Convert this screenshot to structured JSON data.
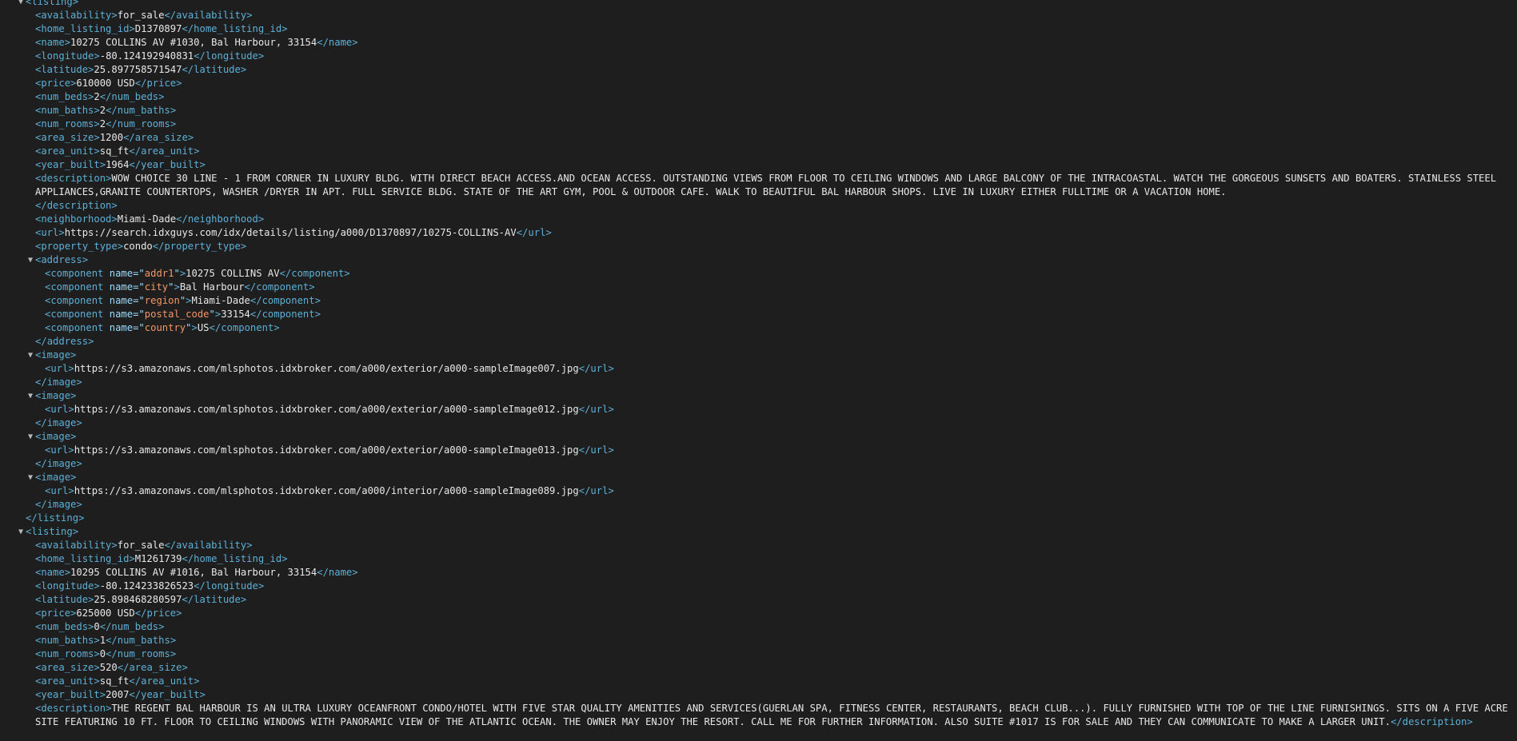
{
  "toggle_glyph": "▼",
  "lines": [
    {
      "d": 1,
      "k": "open",
      "tag": "listing",
      "toggle": true
    },
    {
      "d": 2,
      "k": "el",
      "tag": "availability",
      "text": "for_sale"
    },
    {
      "d": 2,
      "k": "el",
      "tag": "home_listing_id",
      "text": "D1370897"
    },
    {
      "d": 2,
      "k": "el",
      "tag": "name",
      "text": "10275 COLLINS AV #1030, Bal Harbour, 33154"
    },
    {
      "d": 2,
      "k": "el",
      "tag": "longitude",
      "text": "-80.124192940831"
    },
    {
      "d": 2,
      "k": "el",
      "tag": "latitude",
      "text": "25.897758571547"
    },
    {
      "d": 2,
      "k": "el",
      "tag": "price",
      "text": "610000 USD"
    },
    {
      "d": 2,
      "k": "el",
      "tag": "num_beds",
      "text": "2"
    },
    {
      "d": 2,
      "k": "el",
      "tag": "num_baths",
      "text": "2"
    },
    {
      "d": 2,
      "k": "el",
      "tag": "num_rooms",
      "text": "2"
    },
    {
      "d": 2,
      "k": "el",
      "tag": "area_size",
      "text": "1200"
    },
    {
      "d": 2,
      "k": "el",
      "tag": "area_unit",
      "text": "sq_ft"
    },
    {
      "d": 2,
      "k": "el",
      "tag": "year_built",
      "text": "1964"
    },
    {
      "d": 2,
      "k": "desc",
      "tag": "description",
      "text": "WOW CHOICE 30 LINE - 1 FROM CORNER IN LUXURY BLDG. WITH DIRECT BEACH ACCESS.AND OCEAN ACCESS. OUTSTANDING VIEWS FROM FLOOR TO CEILING WINDOWS AND LARGE BALCONY OF THE INTRACOASTAL. WATCH THE GORGEOUS SUNSETS AND BOATERS. STAINLESS STEEL APPLIANCES,GRANITE COUNTERTOPS, WASHER /DRYER IN APT. FULL SERVICE BLDG. STATE OF THE ART GYM, POOL & OUTDOOR CAFE. WALK TO BEAUTIFUL BAL HARBOUR SHOPS. LIVE IN LUXURY EITHER FULLTIME OR A VACATION HOME."
    },
    {
      "d": 2,
      "k": "close",
      "tag": "description"
    },
    {
      "d": 2,
      "k": "el",
      "tag": "neighborhood",
      "text": "Miami-Dade"
    },
    {
      "d": 2,
      "k": "el",
      "tag": "url",
      "text": "https://search.idxguys.com/idx/details/listing/a000/D1370897/10275-COLLINS-AV"
    },
    {
      "d": 2,
      "k": "el",
      "tag": "property_type",
      "text": "condo"
    },
    {
      "d": 2,
      "k": "open",
      "tag": "address",
      "toggle": true
    },
    {
      "d": 3,
      "k": "attr",
      "tag": "component",
      "an": "name",
      "av": "addr1",
      "text": "10275 COLLINS AV"
    },
    {
      "d": 3,
      "k": "attr",
      "tag": "component",
      "an": "name",
      "av": "city",
      "text": "Bal Harbour"
    },
    {
      "d": 3,
      "k": "attr",
      "tag": "component",
      "an": "name",
      "av": "region",
      "text": "Miami-Dade"
    },
    {
      "d": 3,
      "k": "attr",
      "tag": "component",
      "an": "name",
      "av": "postal_code",
      "text": "33154"
    },
    {
      "d": 3,
      "k": "attr",
      "tag": "component",
      "an": "name",
      "av": "country",
      "text": "US"
    },
    {
      "d": 2,
      "k": "close",
      "tag": "address"
    },
    {
      "d": 2,
      "k": "open",
      "tag": "image",
      "toggle": true
    },
    {
      "d": 3,
      "k": "el",
      "tag": "url",
      "text": "https://s3.amazonaws.com/mlsphotos.idxbroker.com/a000/exterior/a000-sampleImage007.jpg"
    },
    {
      "d": 2,
      "k": "close",
      "tag": "image"
    },
    {
      "d": 2,
      "k": "open",
      "tag": "image",
      "toggle": true
    },
    {
      "d": 3,
      "k": "el",
      "tag": "url",
      "text": "https://s3.amazonaws.com/mlsphotos.idxbroker.com/a000/exterior/a000-sampleImage012.jpg"
    },
    {
      "d": 2,
      "k": "close",
      "tag": "image"
    },
    {
      "d": 2,
      "k": "open",
      "tag": "image",
      "toggle": true
    },
    {
      "d": 3,
      "k": "el",
      "tag": "url",
      "text": "https://s3.amazonaws.com/mlsphotos.idxbroker.com/a000/exterior/a000-sampleImage013.jpg"
    },
    {
      "d": 2,
      "k": "close",
      "tag": "image"
    },
    {
      "d": 2,
      "k": "open",
      "tag": "image",
      "toggle": true
    },
    {
      "d": 3,
      "k": "el",
      "tag": "url",
      "text": "https://s3.amazonaws.com/mlsphotos.idxbroker.com/a000/interior/a000-sampleImage089.jpg"
    },
    {
      "d": 2,
      "k": "close",
      "tag": "image"
    },
    {
      "d": 1,
      "k": "close",
      "tag": "listing"
    },
    {
      "d": 1,
      "k": "open",
      "tag": "listing",
      "toggle": true
    },
    {
      "d": 2,
      "k": "el",
      "tag": "availability",
      "text": "for_sale"
    },
    {
      "d": 2,
      "k": "el",
      "tag": "home_listing_id",
      "text": "M1261739"
    },
    {
      "d": 2,
      "k": "el",
      "tag": "name",
      "text": "10295 COLLINS AV #1016, Bal Harbour, 33154"
    },
    {
      "d": 2,
      "k": "el",
      "tag": "longitude",
      "text": "-80.124233826523"
    },
    {
      "d": 2,
      "k": "el",
      "tag": "latitude",
      "text": "25.898468280597"
    },
    {
      "d": 2,
      "k": "el",
      "tag": "price",
      "text": "625000 USD"
    },
    {
      "d": 2,
      "k": "el",
      "tag": "num_beds",
      "text": "0"
    },
    {
      "d": 2,
      "k": "el",
      "tag": "num_baths",
      "text": "1"
    },
    {
      "d": 2,
      "k": "el",
      "tag": "num_rooms",
      "text": "0"
    },
    {
      "d": 2,
      "k": "el",
      "tag": "area_size",
      "text": "520"
    },
    {
      "d": 2,
      "k": "el",
      "tag": "area_unit",
      "text": "sq_ft"
    },
    {
      "d": 2,
      "k": "el",
      "tag": "year_built",
      "text": "2007"
    },
    {
      "d": 2,
      "k": "desc",
      "tag": "description",
      "text": "THE REGENT BAL HARBOUR IS AN ULTRA LUXURY OCEANFRONT CONDO/HOTEL WITH FIVE STAR QUALITY AMENITIES AND SERVICES(GUERLAN SPA, FITNESS CENTER, RESTAURANTS, BEACH CLUB...). FULLY FURNISHED WITH TOP OF THE LINE FURNISHINGS. SITS ON A FIVE ACRE SITE FEATURING 10 FT. FLOOR TO CEILING WINDOWS WITH PANORAMIC VIEW OF THE ATLANTIC OCEAN. THE OWNER MAY ENJOY THE RESORT. CALL ME FOR FURTHER INFORMATION. ALSO SUITE #1017 IS FOR SALE AND THEY CAN COMMUNICATE TO MAKE A LARGER UNIT.",
      "inline_close": true
    }
  ]
}
